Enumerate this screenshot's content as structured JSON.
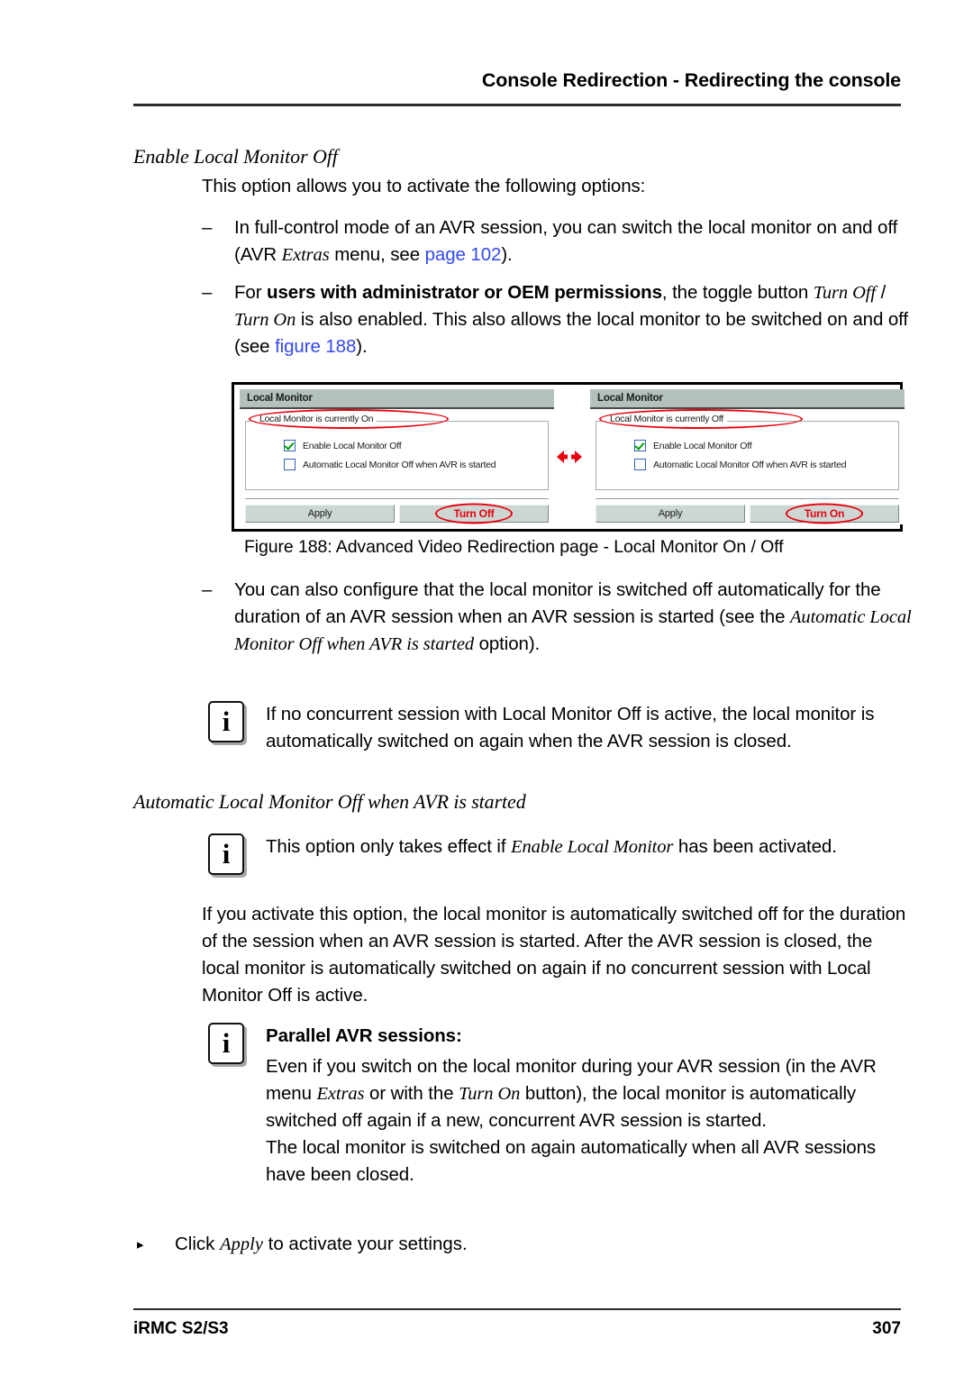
{
  "header": {
    "title": "Console Redirection - Redirecting the console"
  },
  "footer": {
    "left": "iRMC S2/S3",
    "page_number": "307"
  },
  "colors": {
    "link": "#3348ee",
    "accent_red": "#e8000d",
    "panel_header": "#b3c0bb",
    "button_face": "#ccd6d2",
    "checkbox_border": "#2f61b5",
    "checkmark": "#00a000"
  },
  "sections": {
    "enable_local_monitor_off": {
      "heading": "Enable Local Monitor Off",
      "intro": "This option allows you to activate the following options:",
      "bullets": [
        {
          "mark": "–",
          "parts": [
            {
              "text": "In full-control mode of an AVR session, you can switch the local monitor on and off (AVR ",
              "style": "normal"
            },
            {
              "text": "Extras",
              "style": "italic"
            },
            {
              "text": " menu, see ",
              "style": "normal"
            },
            {
              "text": "page 102",
              "style": "link"
            },
            {
              "text": ").",
              "style": "normal"
            }
          ]
        },
        {
          "mark": "–",
          "parts": [
            {
              "text": "For ",
              "style": "normal"
            },
            {
              "text": "users with administrator or OEM permissions",
              "style": "bold"
            },
            {
              "text": ", the toggle button ",
              "style": "normal"
            },
            {
              "text": "Turn Off",
              "style": "italic"
            },
            {
              "text": " / ",
              "style": "normal"
            },
            {
              "text": "Turn On",
              "style": "italic"
            },
            {
              "text": " is also enabled. This also allows the local monitor to be switched on and off (see ",
              "style": "normal"
            },
            {
              "text": "figure 188",
              "style": "link"
            },
            {
              "text": ").",
              "style": "normal"
            }
          ]
        }
      ],
      "bullet_after_figure": {
        "mark": "–",
        "parts": [
          {
            "text": "You can also configure that the local monitor is switched off automatically for the duration of an AVR session when an AVR session is started (see the ",
            "style": "normal"
          },
          {
            "text": "Automatic Local Monitor Off when AVR is started",
            "style": "italic"
          },
          {
            "text": " option).",
            "style": "normal"
          }
        ]
      },
      "note": {
        "icon": "info-icon",
        "icon_glyph": "i",
        "text": "If no concurrent session with Local Monitor Off is active, the local monitor is automatically switched on again when the AVR session is closed."
      }
    },
    "automatic_local_monitor_off": {
      "heading": "Automatic Local Monitor Off when AVR is started",
      "note_1": {
        "icon": "info-icon",
        "icon_glyph": "i",
        "parts": [
          {
            "text": "This option only takes effect if ",
            "style": "normal"
          },
          {
            "text": "Enable Local Monitor",
            "style": "italic"
          },
          {
            "text": " has been activated.",
            "style": "normal"
          }
        ]
      },
      "paragraph": "If you activate this option, the local monitor is automatically switched off for the duration of the session when an AVR session is started. After the AVR session is closed, the local monitor is automatically switched on again if no concurrent session with Local Monitor Off is active.",
      "note_2": {
        "icon": "info-icon",
        "icon_glyph": "i",
        "title": "Parallel AVR sessions:",
        "parts": [
          {
            "text": "Even if you switch on the local monitor during your AVR session (in the AVR menu ",
            "style": "normal"
          },
          {
            "text": "Extras",
            "style": "italic"
          },
          {
            "text": " or with the ",
            "style": "normal"
          },
          {
            "text": "Turn On",
            "style": "italic"
          },
          {
            "text": " button), the local monitor is automatically switched off again if a new, concurrent AVR session is started.",
            "style": "normal"
          }
        ],
        "paragraph_2": "The local monitor is switched on again automatically when all AVR sessions have been closed."
      },
      "action": {
        "mark": "▸",
        "parts": [
          {
            "text": "Click ",
            "style": "normal"
          },
          {
            "text": "Apply",
            "style": "italic"
          },
          {
            "text": " to activate your settings.",
            "style": "normal"
          }
        ]
      }
    }
  },
  "figure": {
    "caption": "Figure 188: Advanced Video Redirection page - Local Monitor On / Off",
    "arrow_icon": "double-headed-arrow-icon",
    "panels": [
      {
        "header": "Local Monitor",
        "group_legend": "Local Monitor is currently On",
        "checkboxes": [
          {
            "label": "Enable Local Monitor Off",
            "checked": true
          },
          {
            "label": "Automatic Local Monitor Off when AVR is started",
            "checked": false
          }
        ],
        "buttons": [
          {
            "label": "Apply",
            "accent": false
          },
          {
            "label": "Turn Off",
            "accent": true
          }
        ]
      },
      {
        "header": "Local Monitor",
        "group_legend": "Local Monitor is currently Off",
        "checkboxes": [
          {
            "label": "Enable Local Monitor Off",
            "checked": true
          },
          {
            "label": "Automatic Local Monitor Off when AVR is started",
            "checked": false
          }
        ],
        "buttons": [
          {
            "label": "Apply",
            "accent": false
          },
          {
            "label": "Turn On",
            "accent": true
          }
        ]
      }
    ]
  }
}
